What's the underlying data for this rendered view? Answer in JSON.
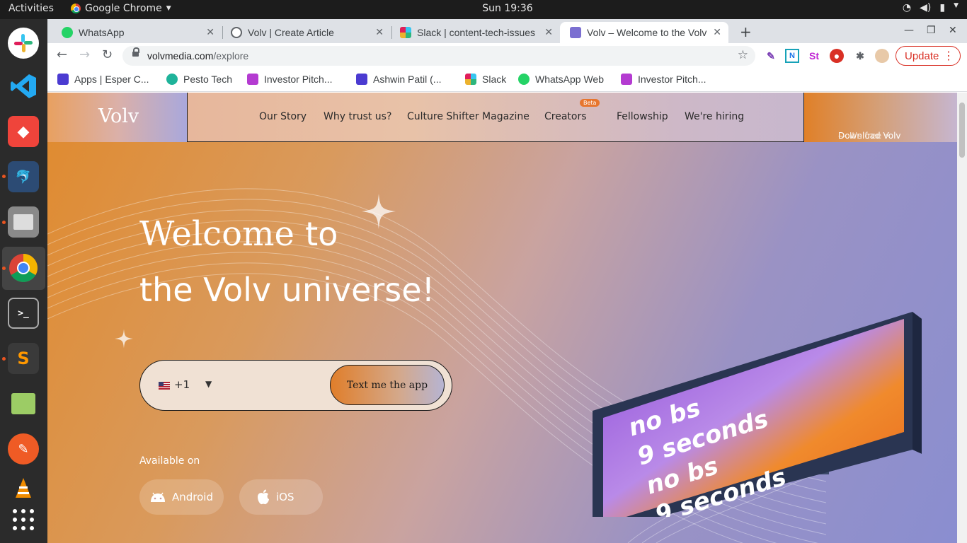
{
  "system": {
    "activities": "Activities",
    "app_menu": "Google Chrome",
    "clock": "Sun 19:36"
  },
  "dock": [
    "slack",
    "vscode",
    "anydesk",
    "mysql-workbench",
    "files",
    "chrome",
    "terminal",
    "sublime-text",
    "image-viewer",
    "postman",
    "vlc",
    "show-apps"
  ],
  "browser": {
    "tabs": [
      {
        "title": "WhatsApp",
        "icon": "whatsapp-icon",
        "color": "#25d366"
      },
      {
        "title": "Volv | Create Article",
        "icon": "globe-icon",
        "color": "#5f6368"
      },
      {
        "title": "Slack | content-tech-issues",
        "icon": "slack-icon",
        "color": "#e01e5a"
      },
      {
        "title": "Volv – Welcome to the Volv",
        "icon": "volv-icon",
        "color": "#7b6fd1",
        "active": true
      }
    ],
    "url_host": "volvmedia.com",
    "url_path": "/explore",
    "update_label": "Update",
    "bookmarks": [
      {
        "label": "Apps | Esper C...",
        "color": "#4b3bd1"
      },
      {
        "label": "Pesto Tech",
        "color": "#1fb39a"
      },
      {
        "label": "Investor Pitch...",
        "color": "#b43bd1"
      },
      {
        "label": "Ashwin Patil (...",
        "color": "#4b3bd1"
      },
      {
        "label": "Slack",
        "color": "#e01e5a"
      },
      {
        "label": "WhatsApp Web",
        "color": "#25d366"
      },
      {
        "label": "Investor Pitch...",
        "color": "#b43bd1"
      }
    ]
  },
  "site": {
    "logo": "Volv",
    "nav": [
      "Our Story",
      "Why trust us?",
      "Culture Shifter Magazine",
      "Creators",
      "Fellowship",
      "We're hiring"
    ],
    "beta_badge": "Beta",
    "download_cta": "Download Volv",
    "download_cta_suffix": " — It's free ⚡",
    "hero_welcome": "Welcome",
    "hero_to": "to",
    "hero_line2": "the Volv universe!",
    "country_code": "+1",
    "text_app_button": "Text me the app",
    "available_on": "Available on",
    "android_label": "Android",
    "ios_label": "iOS",
    "billboard_lines": [
      "no bs",
      "9 seconds",
      "no bs",
      "9 seconds"
    ]
  }
}
